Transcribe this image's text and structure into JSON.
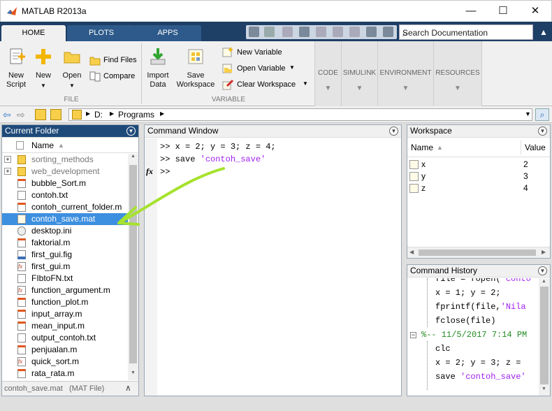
{
  "window": {
    "title": "MATLAB R2013a",
    "minimize": "—",
    "maximize": "☐",
    "close": "✕"
  },
  "tabs": [
    {
      "label": "HOME"
    },
    {
      "label": "PLOTS"
    },
    {
      "label": "APPS"
    }
  ],
  "search": {
    "placeholder": "Search Documentation"
  },
  "ribbon": {
    "file": {
      "new_script": "New Script",
      "new_script_l1": "New",
      "new_script_l2": "Script",
      "new": "New",
      "open": "Open",
      "find_files": "Find Files",
      "compare": "Compare",
      "group": "FILE"
    },
    "variable": {
      "import_l1": "Import",
      "import_l2": "Data",
      "save_l1": "Save",
      "save_l2": "Workspace",
      "new_variable": "New Variable",
      "open_variable": "Open Variable",
      "clear_workspace": "Clear Workspace",
      "group": "VARIABLE"
    },
    "collapsed": [
      "CODE",
      "SIMULINK",
      "ENVIRONMENT",
      "RESOURCES"
    ]
  },
  "address": {
    "drive": "D:",
    "folder": "Programs",
    "sep": "▶"
  },
  "current_folder": {
    "title": "Current Folder",
    "column": "Name",
    "items": [
      {
        "name": "sorting_methods",
        "type": "folder"
      },
      {
        "name": "web_development",
        "type": "folder"
      },
      {
        "name": "bubble_Sort.m",
        "type": "m"
      },
      {
        "name": "contoh.txt",
        "type": "txt"
      },
      {
        "name": "contoh_current_folder.m",
        "type": "m"
      },
      {
        "name": "contoh_save.mat",
        "type": "mat",
        "selected": true
      },
      {
        "name": "desktop.ini",
        "type": "ini"
      },
      {
        "name": "faktorial.m",
        "type": "m"
      },
      {
        "name": "first_gui.fig",
        "type": "fig"
      },
      {
        "name": "first_gui.m",
        "type": "fx"
      },
      {
        "name": "FIbtoFN.txt",
        "type": "txt"
      },
      {
        "name": "function_argument.m",
        "type": "fx"
      },
      {
        "name": "function_plot.m",
        "type": "m"
      },
      {
        "name": "input_array.m",
        "type": "m"
      },
      {
        "name": "mean_input.m",
        "type": "m"
      },
      {
        "name": "output_contoh.txt",
        "type": "txt"
      },
      {
        "name": "penjualan.m",
        "type": "m"
      },
      {
        "name": "quick_sort.m",
        "type": "fx"
      },
      {
        "name": "rata_rata.m",
        "type": "m"
      }
    ],
    "details": "contoh_save.mat",
    "details_type": "(MAT File)"
  },
  "command_window": {
    "title": "Command Window",
    "lines": [
      {
        "prompt": ">>",
        "code": " x = 2; y = 3; z = 4;",
        "str": ""
      },
      {
        "prompt": ">>",
        "code": " save ",
        "str": "'contoh_save'"
      },
      {
        "prompt": ">>",
        "code": "",
        "str": ""
      }
    ],
    "fx": "fx"
  },
  "workspace": {
    "title": "Workspace",
    "col_name": "Name",
    "col_value": "Value",
    "vars": [
      {
        "name": "x",
        "value": "2"
      },
      {
        "name": "y",
        "value": "3"
      },
      {
        "name": "z",
        "value": "4"
      }
    ]
  },
  "history": {
    "title": "Command History",
    "lines": [
      {
        "code": "file = fopen(",
        "str": "'conto"
      },
      {
        "code": "x = 1; y = 2;",
        "str": ""
      },
      {
        "code": "fprintf(file,",
        "str": "'Nila"
      },
      {
        "code": "fclose(file)",
        "str": ""
      },
      {
        "code": "%-- 11/5/2017 7:14 PM",
        "str": "",
        "session": true
      },
      {
        "code": "clc",
        "str": ""
      },
      {
        "code": "x = 2; y = 3; z = ",
        "str": ""
      },
      {
        "code": "save ",
        "str": "'contoh_save'"
      }
    ]
  },
  "colors": {
    "accent": "#1e3f66",
    "selection": "#3d8fdf",
    "arrow": "#a6e22e",
    "string": "#a020f0",
    "comment": "#228b22"
  }
}
